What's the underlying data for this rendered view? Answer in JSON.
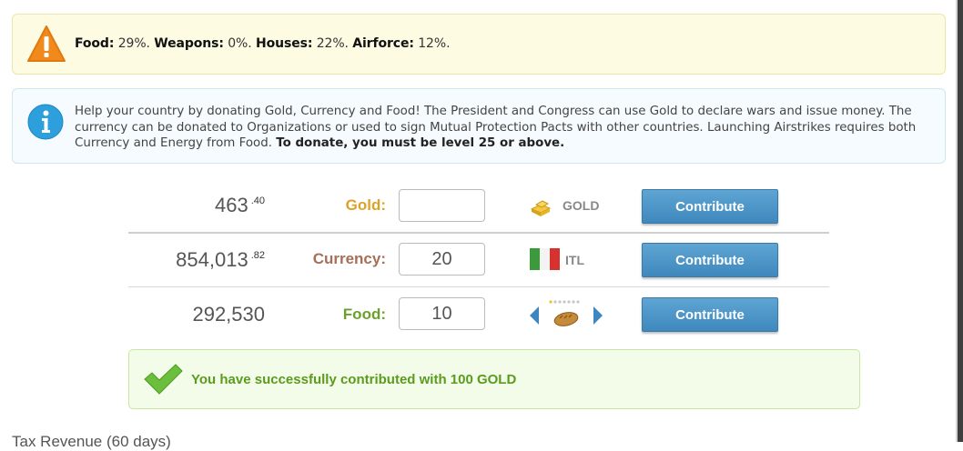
{
  "warning": {
    "items": [
      {
        "label": "Food:",
        "value": "29%."
      },
      {
        "label": "Weapons:",
        "value": "0%."
      },
      {
        "label": "Houses:",
        "value": "22%."
      },
      {
        "label": "Airforce:",
        "value": "12%."
      }
    ]
  },
  "info": {
    "text": "Help your country by donating Gold, Currency and Food! The President and Congress can use Gold to declare wars and issue money. The currency can be donated to Organizations or used to sign Mutual Protection Pacts with other countries. Launching Airstrikes requires both Currency and Energy from Food.",
    "bold_text": "To donate, you must be level 25 or above."
  },
  "donate": {
    "rows": [
      {
        "amount": "463",
        "decimals": ".40",
        "label": "Gold:",
        "input_value": "",
        "unit": "GOLD",
        "button": "Contribute"
      },
      {
        "amount": "854,013",
        "decimals": ".82",
        "label": "Currency:",
        "input_value": "20",
        "unit": "ITL",
        "button": "Contribute"
      },
      {
        "amount": "292,530",
        "decimals": "",
        "label": "Food:",
        "input_value": "10",
        "unit": "",
        "button": "Contribute"
      }
    ],
    "food_quality_stars": 1,
    "food_quality_max": 7
  },
  "success": {
    "message": "You have successfully contributed with 100 GOLD"
  },
  "next_section": {
    "title": "Tax Revenue (60 days)"
  },
  "icons": {
    "warning": "warning-triangle-icon",
    "info": "info-circle-icon",
    "gold": "gold-bars-icon",
    "flag": "italy-flag-icon",
    "food": "bread-icon",
    "prev": "arrow-left-icon",
    "next": "arrow-right-icon",
    "success": "checkmark-icon"
  },
  "colors": {
    "gold_label": "#dca22a",
    "currency_label": "#a66f58",
    "food_label": "#6aa02b",
    "button": "#4a93c7",
    "success_text": "#5b9b1e"
  }
}
